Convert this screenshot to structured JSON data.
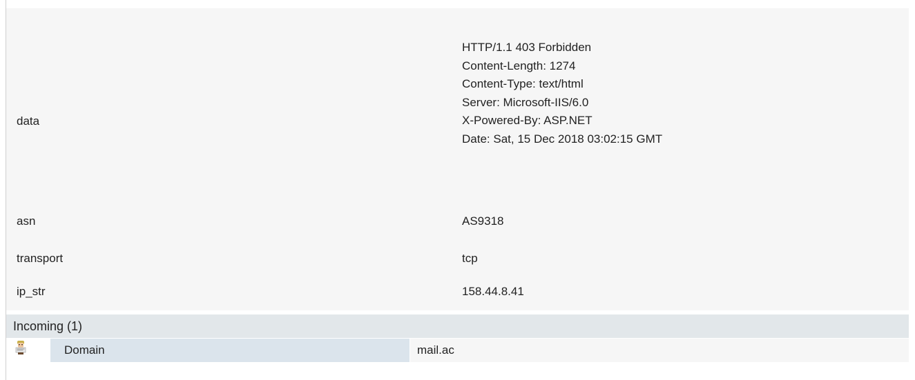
{
  "properties": {
    "data": {
      "key": "data",
      "lines": [
        "HTTP/1.1 403 Forbidden",
        "Content-Length: 1274",
        "Content-Type: text/html",
        "Server: Microsoft-IIS/6.0",
        "X-Powered-By: ASP.NET",
        "Date: Sat, 15 Dec 2018 03:02:15 GMT"
      ]
    },
    "asn": {
      "key": "asn",
      "value": "AS9318"
    },
    "transport": {
      "key": "transport",
      "value": "tcp"
    },
    "ip_str": {
      "key": "ip_str",
      "value": "158.44.8.41"
    }
  },
  "incoming": {
    "title": "Incoming (1)",
    "items": [
      {
        "icon": "entity-avatar-icon",
        "type": "Domain",
        "value": "mail.ac"
      }
    ]
  }
}
